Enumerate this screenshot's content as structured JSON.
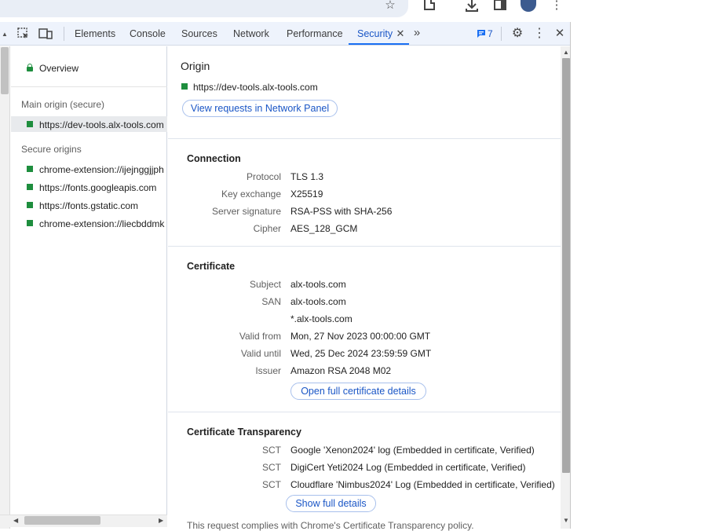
{
  "browser": {
    "icons": [
      "star-icon",
      "extensions-icon",
      "download-icon",
      "side-panel-icon",
      "avatar",
      "kebab-menu-icon"
    ]
  },
  "toolbar": {
    "tabs": [
      {
        "label": "Elements"
      },
      {
        "label": "Console"
      },
      {
        "label": "Sources"
      },
      {
        "label": "Network"
      },
      {
        "label": "Performance"
      },
      {
        "label": "Security"
      }
    ],
    "active_tab": "Security",
    "issues_count": "7"
  },
  "sidebar": {
    "overview_label": "Overview",
    "main_origin_heading": "Main origin (secure)",
    "main_origin": "https://dev-tools.alx-tools.com",
    "secure_origins_heading": "Secure origins",
    "secure_origins": [
      "chrome-extension://ijejnggjjph",
      "https://fonts.googleapis.com",
      "https://fonts.gstatic.com",
      "chrome-extension://liecbddmk"
    ]
  },
  "main": {
    "origin_heading": "Origin",
    "origin_url": "https://dev-tools.alx-tools.com",
    "view_requests_label": "View requests in Network Panel",
    "connection": {
      "heading": "Connection",
      "rows": [
        {
          "label": "Protocol",
          "value": "TLS 1.3"
        },
        {
          "label": "Key exchange",
          "value": "X25519"
        },
        {
          "label": "Server signature",
          "value": "RSA-PSS with SHA-256"
        },
        {
          "label": "Cipher",
          "value": "AES_128_GCM"
        }
      ]
    },
    "certificate": {
      "heading": "Certificate",
      "rows": [
        {
          "label": "Subject",
          "value": "alx-tools.com"
        },
        {
          "label": "SAN",
          "value": "alx-tools.com"
        },
        {
          "label": "",
          "value": "*.alx-tools.com"
        },
        {
          "label": "Valid from",
          "value": "Mon, 27 Nov 2023 00:00:00 GMT"
        },
        {
          "label": "Valid until",
          "value": "Wed, 25 Dec 2024 23:59:59 GMT"
        },
        {
          "label": "Issuer",
          "value": "Amazon RSA 2048 M02"
        }
      ],
      "details_button": "Open full certificate details"
    },
    "transparency": {
      "heading": "Certificate Transparency",
      "rows": [
        {
          "label": "SCT",
          "value": "Google 'Xenon2024' log (Embedded in certificate, Verified)"
        },
        {
          "label": "SCT",
          "value": "DigiCert Yeti2024 Log (Embedded in certificate, Verified)"
        },
        {
          "label": "SCT",
          "value": "Cloudflare 'Nimbus2024' Log (Embedded in certificate, Verified)"
        }
      ],
      "show_details_button": "Show full details",
      "compliance_text": "This request complies with Chrome's Certificate Transparency policy."
    }
  },
  "colors": {
    "accent": "#1a56c6",
    "secure_green": "#1e8e3e",
    "toolbar_bg": "#eef3fc"
  }
}
